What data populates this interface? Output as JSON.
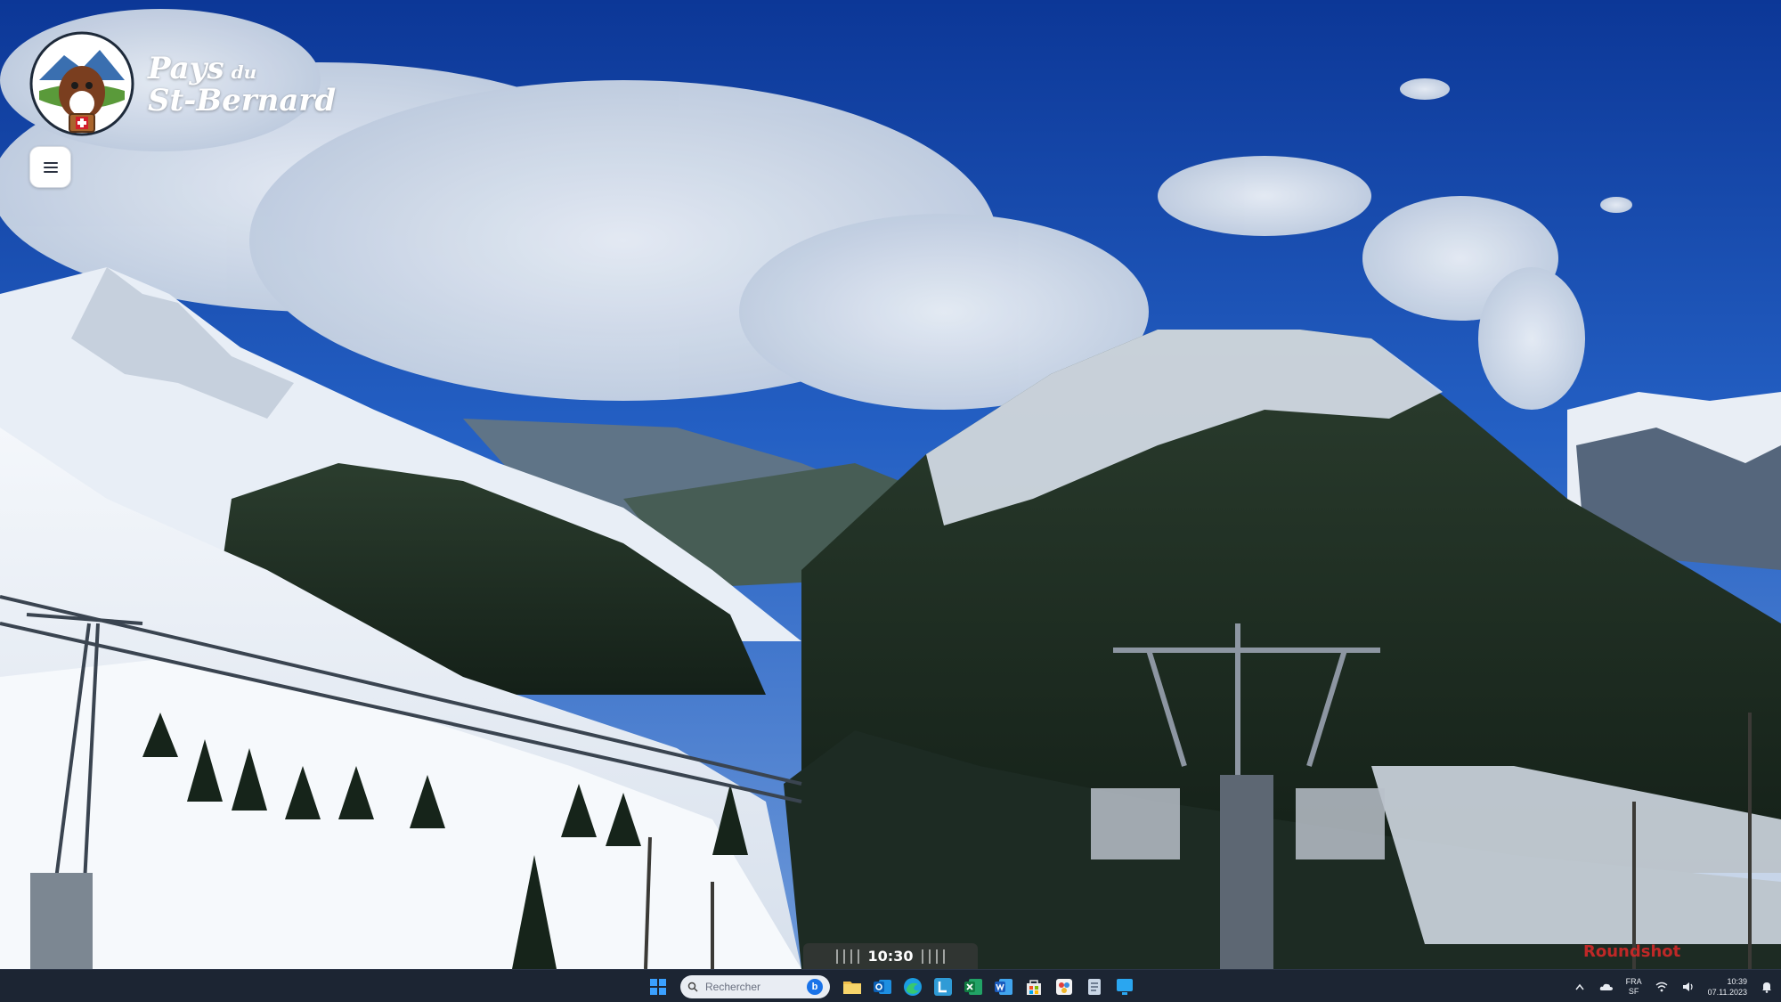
{
  "brand": {
    "name_line1": "Pays",
    "name_small": "du",
    "name_line2": "St-Bernard"
  },
  "menu": {
    "icon": "hamburger-menu-icon"
  },
  "timeline": {
    "time": "10:30"
  },
  "watermark": {
    "text": "Roundshot"
  },
  "taskbar": {
    "search_placeholder": "Rechercher",
    "search_badge": "b",
    "apps": [
      "start-icon",
      "file-explorer-icon",
      "outlook-icon",
      "edge-icon",
      "app-l-icon",
      "excel-icon",
      "word-icon",
      "store-icon",
      "paint-icon",
      "notepad-icon",
      "app-blue-icon"
    ],
    "tray": {
      "lang_top": "FRA",
      "lang_bottom": "SF",
      "time": "10:39",
      "date": "07.11.2023"
    }
  },
  "colors": {
    "sky_top": "#0d3a9a",
    "sky_bottom": "#3f79d2",
    "taskbar": "#1c2533"
  }
}
